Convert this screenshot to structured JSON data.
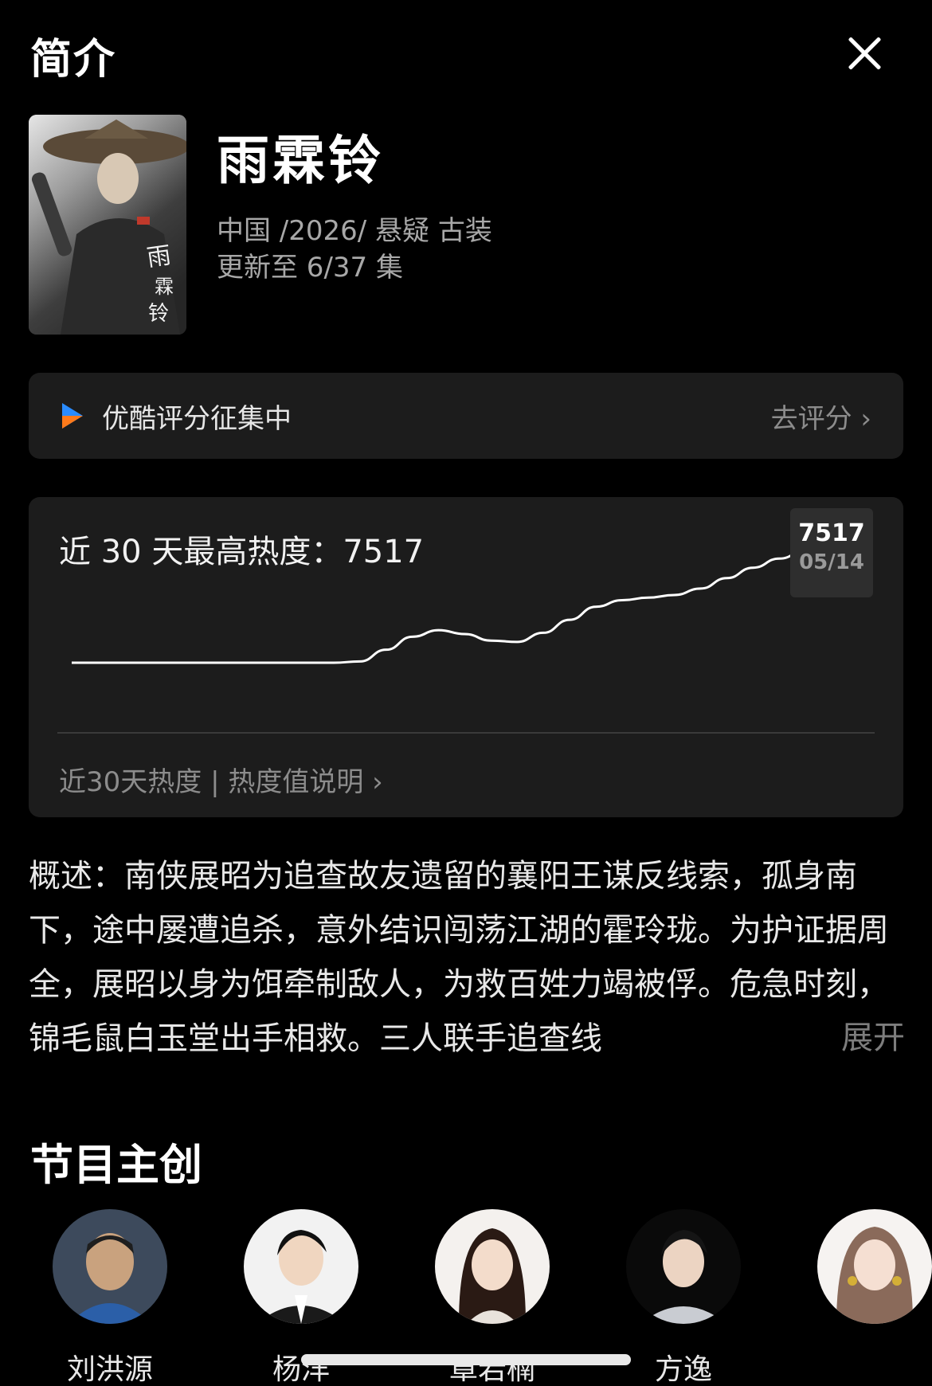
{
  "header": {
    "title": "简介"
  },
  "show": {
    "title": "雨霖铃",
    "meta_line1": "中国 /2026/ 悬疑 古装",
    "meta_line2": "更新至 6/37 集"
  },
  "rating": {
    "text": "优酷评分征集中",
    "action": "去评分 ›"
  },
  "heat": {
    "title": "近 30 天最高热度：7517",
    "tooltip_value": "7517",
    "tooltip_date": "05/14",
    "footer": "近30天热度 | 热度值说明 ›"
  },
  "chart_data": {
    "type": "line",
    "title": "近 30 天最高热度：7517",
    "series": [
      {
        "values": [
          3050,
          3050,
          3050,
          3050,
          3050,
          3050,
          3050,
          3050,
          3050,
          3050,
          3050,
          3100,
          3550,
          4050,
          4300,
          4150,
          3900,
          3850,
          4200,
          4700,
          5200,
          5450,
          5550,
          5650,
          5900,
          6300,
          6700,
          7050,
          7350,
          7517
        ]
      }
    ],
    "highlight": {
      "value": 7517,
      "date": "05/14"
    },
    "grid": false
  },
  "synopsis": {
    "text": "概述：南侠展昭为追查故友遗留的襄阳王谋反线索，孤身南下，途中屡遭追杀，意外结识闯荡江湖的霍玲珑。为护证据周全，展昭以身为饵牵制敌人，为救百姓力竭被俘。危急时刻，锦毛鼠白玉堂出手相救。三人联手追查线",
    "expand": "展开"
  },
  "cast": {
    "title": "节目主创",
    "members": [
      {
        "name": "刘洪源"
      },
      {
        "name": "杨洋"
      },
      {
        "name": "章若楠"
      },
      {
        "name": "方逸"
      },
      {
        "name": ""
      }
    ]
  },
  "colors": {
    "background": "#000000",
    "card": "#1c1c1c",
    "muted_text": "#8c8c8c",
    "logo_blue": "#2a8cff",
    "logo_orange": "#ff7a1a"
  }
}
